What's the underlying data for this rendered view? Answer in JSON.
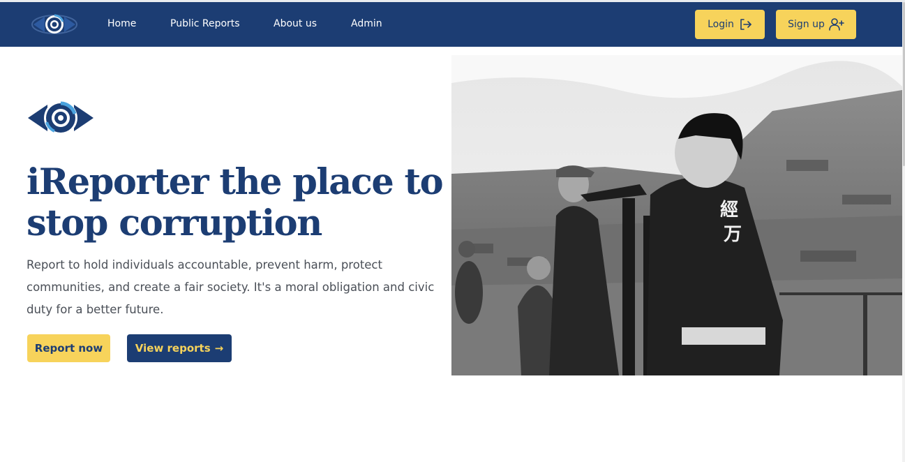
{
  "nav": {
    "logo_icon": "eye-logo-icon",
    "links": [
      "Home",
      "Public Reports",
      "About us",
      "Admin"
    ],
    "login_label": "Login",
    "login_icon": "login-arrow-icon",
    "signup_label": "Sign up",
    "signup_icon": "user-plus-icon"
  },
  "hero": {
    "logo_icon": "eye-logo-icon",
    "title": "iReporter the place to stop corruption",
    "description": "Report to hold individuals accountable, prevent harm, protect communities, and create a fair society. It's a moral obligation and civic duty for a better future.",
    "report_button": "Report now",
    "view_button": "View reports",
    "view_arrow": "→",
    "image_icon": "hero-photo"
  },
  "colors": {
    "navy": "#1c3d73",
    "yellow": "#f7d35b",
    "text_gray": "#4a4f57",
    "white": "#ffffff"
  }
}
